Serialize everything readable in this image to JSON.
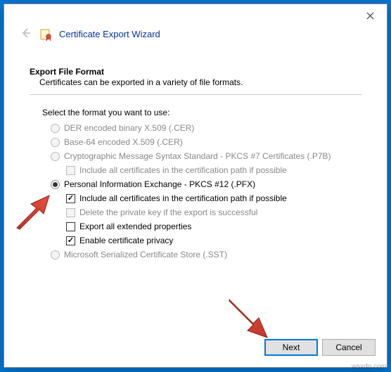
{
  "window": {
    "title": "Certificate Export Wizard"
  },
  "section": {
    "heading": "Export File Format",
    "subtitle": "Certificates can be exported in a variety of file formats."
  },
  "prompt": "Select the format you want to use:",
  "options": {
    "der": "DER encoded binary X.509 (.CER)",
    "base64": "Base-64 encoded X.509 (.CER)",
    "pkcs7": "Cryptographic Message Syntax Standard - PKCS #7 Certificates (.P7B)",
    "pkcs7_include": "Include all certificates in the certification path if possible",
    "pfx": "Personal Information Exchange - PKCS #12 (.PFX)",
    "pfx_include": "Include all certificates in the certification path if possible",
    "pfx_delete": "Delete the private key if the export is successful",
    "pfx_extended": "Export all extended properties",
    "pfx_privacy": "Enable certificate privacy",
    "sst": "Microsoft Serialized Certificate Store (.SST)"
  },
  "buttons": {
    "next": "Next",
    "cancel": "Cancel"
  },
  "watermark": "wsxdn.com"
}
